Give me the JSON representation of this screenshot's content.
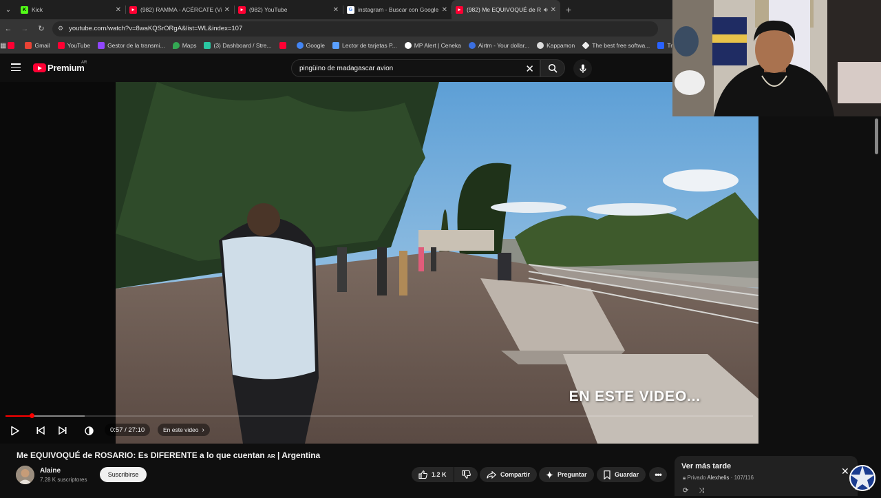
{
  "browser": {
    "tabs": [
      {
        "title": "Kick",
        "favicon": "kick-icon",
        "active": false
      },
      {
        "title": "(982) RAMMA - ACÉRCATE (Vi",
        "favicon": "youtube-icon",
        "active": false
      },
      {
        "title": "(982) YouTube",
        "favicon": "youtube-icon",
        "active": false
      },
      {
        "title": "instagram - Buscar con Google",
        "favicon": "google-icon",
        "active": false
      },
      {
        "title": "(982) Me EQUIVOQUÉ de R",
        "favicon": "youtube-icon",
        "active": true
      }
    ],
    "url": "youtube.com/watch?v=8waKQSrORgA&list=WL&index=107",
    "bookmarks": [
      {
        "label": "",
        "color": "#ff0033"
      },
      {
        "label": "Gmail",
        "color": "#ea4335"
      },
      {
        "label": "YouTube",
        "color": "#ff0033"
      },
      {
        "label": "Gestor de la transmi...",
        "color": "#9146ff"
      },
      {
        "label": "Maps",
        "color": "#34a853"
      },
      {
        "label": "(3) Dashboard / Stre...",
        "color": "#2ac7a2"
      },
      {
        "label": "",
        "color": "#ff0033"
      },
      {
        "label": "Google",
        "color": "#4285f4"
      },
      {
        "label": "Lector de tarjetas P...",
        "color": "#5aa0ff"
      },
      {
        "label": "MP Alert | Ceneka",
        "color": "#ffffff"
      },
      {
        "label": "Airtm - Your dollar...",
        "color": "#3b6fe0"
      },
      {
        "label": "Kappamon",
        "color": "#dddddd"
      },
      {
        "label": "The best free softwa...",
        "color": "#eeeeee"
      },
      {
        "label": "Tradi",
        "color": "#2962ff"
      }
    ]
  },
  "youtube": {
    "logo_text": "Premium",
    "logo_country": "AR",
    "search_value": "pingüino de madagascar avion"
  },
  "player": {
    "overlay_text": "EN ESTE VIDEO...",
    "time_display": "0:57 / 27:10",
    "chapter_label": "En este video",
    "progress_fraction": 0.035,
    "buffer_fraction": 0.106
  },
  "video_info": {
    "title_start": "Me EQUIVOQUÉ de ROSARIO: Es DIFERENTE a lo que cuentan",
    "title_flag": "AR",
    "title_end": "| Argentina",
    "channel_name": "Alaine",
    "subscribers": "7.28 K suscriptores",
    "subscribe_label": "Suscribirse",
    "likes": "1.2 K",
    "share_label": "Compartir",
    "ask_label": "Preguntar",
    "save_label": "Guardar"
  },
  "playlist": {
    "title": "Ver más tarde",
    "privacy": "Privado",
    "owner": "Alexhelis",
    "position": "107/116"
  }
}
